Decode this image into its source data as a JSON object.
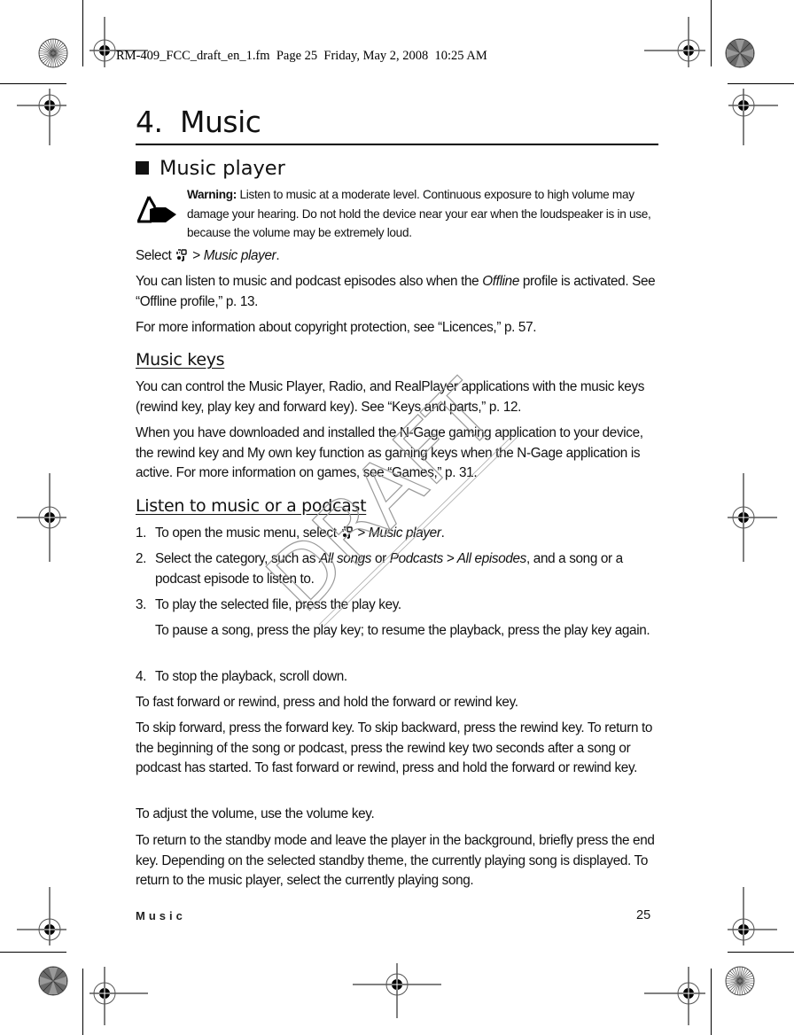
{
  "print_header": "RM-409_FCC_draft_en_1.fm  Page 25  Friday, May 2, 2008  10:25 AM",
  "watermark": "DRAFT",
  "chapter": {
    "number": "4.",
    "title": "Music"
  },
  "section": {
    "title": "Music player",
    "icon": "black-square-bullet"
  },
  "warning": {
    "icon": "warning-hand-icon",
    "label": "Warning:",
    "text": " Listen to music at a moderate level. Continuous exposure to high volume may damage your hearing. Do not hold the device near your ear when the loudspeaker is in use, because the volume may be extremely loud."
  },
  "intro": {
    "select_prefix": "Select ",
    "menu_icon": "menu-key-icon",
    "select_sep": " > ",
    "select_target": "Music player",
    "select_suffix": ".",
    "offline_pre": "You can listen to music and podcast episodes also when the ",
    "offline_em": "Offline",
    "offline_post": " profile is activated. See “Offline profile,” p. 13.",
    "copyright": "For more information about copyright protection, see “Licences,” p. 57."
  },
  "music_keys": {
    "heading": "Music keys",
    "p1": "You can control the Music Player, Radio, and RealPlayer applications with the music keys (rewind key, play key and forward key). See “Keys and parts,” p. 12.",
    "p2": "When you have downloaded and installed the N-Gage gaming application to your device, the rewind key and My own key function as gaming keys when the N-Gage application is active. For more information on games, see “Games,” p. 31."
  },
  "listen": {
    "heading": "Listen to music or a podcast",
    "steps": [
      {
        "num": "1.",
        "pre": "To open the music menu, select ",
        "sep": " > ",
        "em": "Music player",
        "post": "."
      },
      {
        "num": "2.",
        "pre": "Select the category, such as ",
        "em1": "All songs",
        "mid": " or ",
        "em2": "Podcasts > All episodes",
        "post": ", and a song or a podcast episode to listen to."
      },
      {
        "num": "3.",
        "text": "To play the selected file, press the play key.",
        "sub": "To pause a song, press the play key; to resume the playback, press the play key again."
      },
      {
        "num": "4.",
        "text": "To stop the playback, scroll down."
      }
    ],
    "p_fast": "To fast forward or rewind, press and hold the forward or rewind key.",
    "p_skip": "To skip forward, press the forward key. To skip backward, press the rewind key. To return to the beginning of the song or podcast, press the rewind key two seconds after a song or podcast has started. To fast forward or rewind, press and hold the forward or rewind key.",
    "p_volume": "To adjust the volume, use the volume key.",
    "p_standby": "To return to the standby mode and leave the player in the background, briefly press the end key. Depending on the selected standby theme, the currently playing song is displayed. To return to the music player, select the currently playing song."
  },
  "footer": {
    "section": "Music",
    "page": "25"
  }
}
